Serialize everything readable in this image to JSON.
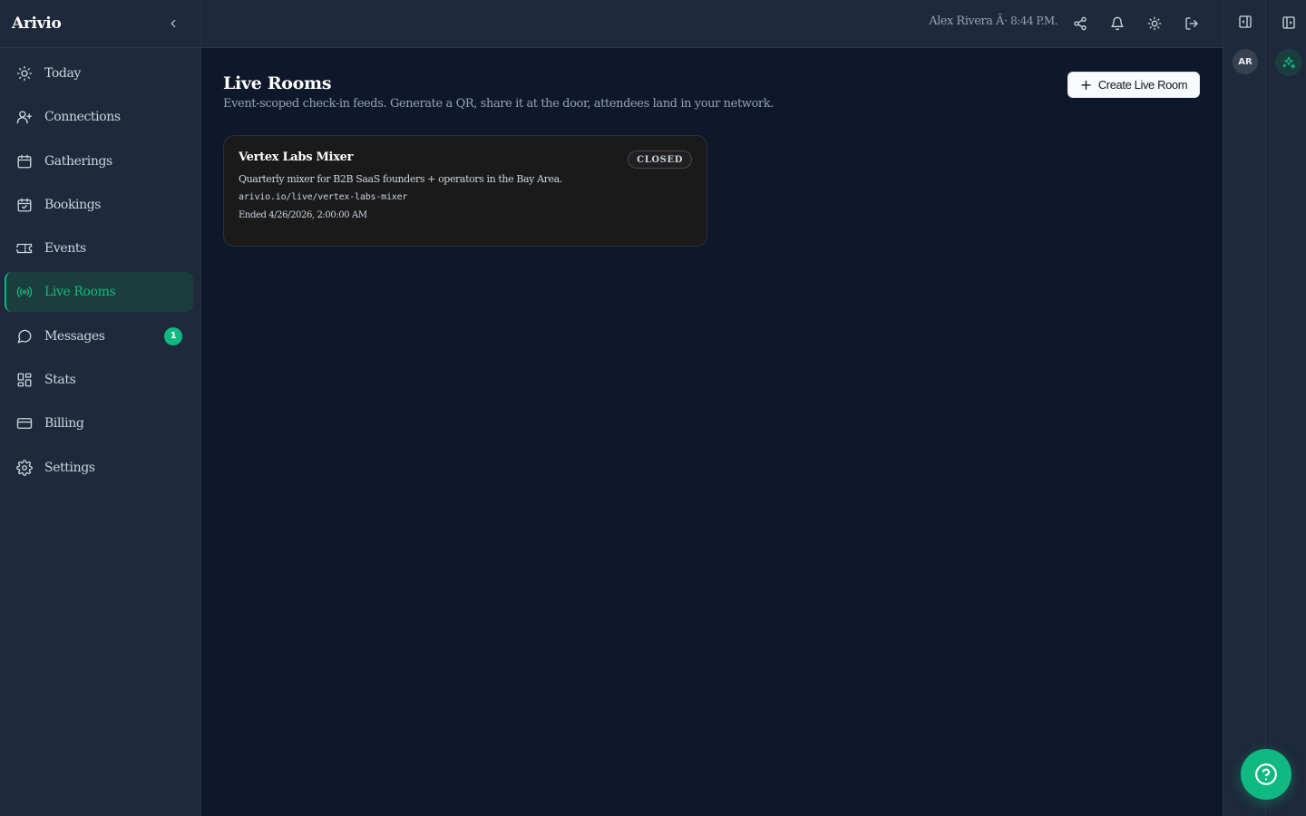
{
  "app": {
    "brand": "Arivio"
  },
  "sidebar": {
    "items": [
      {
        "label": "Today",
        "icon": "sun-icon"
      },
      {
        "label": "Connections",
        "icon": "user-plus-icon"
      },
      {
        "label": "Gatherings",
        "icon": "calendar-icon"
      },
      {
        "label": "Bookings",
        "icon": "calendar-check-icon"
      },
      {
        "label": "Events",
        "icon": "ticket-icon"
      },
      {
        "label": "Live Rooms",
        "icon": "broadcast-icon",
        "active": true
      },
      {
        "label": "Messages",
        "icon": "message-circle-icon",
        "badge": "1"
      },
      {
        "label": "Stats",
        "icon": "dashboard-icon"
      },
      {
        "label": "Billing",
        "icon": "credit-card-icon"
      },
      {
        "label": "Settings",
        "icon": "gear-icon"
      }
    ]
  },
  "header": {
    "user_name": "Alex Rivera",
    "separator": "Â·",
    "time": "8:44 P.M."
  },
  "rail": {
    "avatar_initials": "AR"
  },
  "main": {
    "title": "Live Rooms",
    "subtitle": "Event-scoped check-in feeds. Generate a QR, share it at the door, attendees land in your network.",
    "create_label": "Create Live Room",
    "rooms": [
      {
        "title": "Vertex Labs Mixer",
        "status": "CLOSED",
        "description": "Quarterly mixer for B2B SaaS founders + operators in the Bay Area.",
        "url": "arivio.io/live/vertex-labs-mixer",
        "ended": "Ended 4/26/2026, 2:00:00 AM"
      }
    ]
  },
  "colors": {
    "accent": "#10b981",
    "sidebar_bg": "#1e293b",
    "main_bg": "#0f172a",
    "card_bg": "#1a1a1a"
  }
}
